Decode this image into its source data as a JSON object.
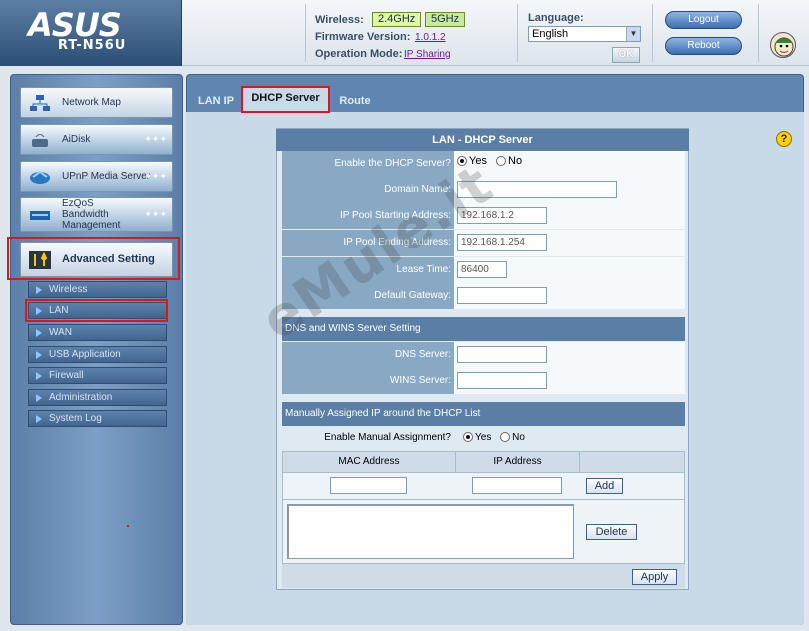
{
  "brand": {
    "logo": "ASUS",
    "model": "RT-N56U"
  },
  "header": {
    "wireless_label": "Wireless:",
    "band1": "2.4GHz",
    "band2": "5GHz",
    "firmware_label": "Firmware Version:",
    "firmware_value": "1.0.1.2",
    "mode_label": "Operation Mode:",
    "mode_value": "IP Sharing",
    "language_label": "Language:",
    "language_value": "English",
    "ok_label": "OK",
    "logout_label": "Logout",
    "reboot_label": "Reboot"
  },
  "sidebar": {
    "main": [
      {
        "label": "Network Map",
        "icon": "network-map-icon"
      },
      {
        "label": "AiDisk",
        "icon": "aidisk-icon"
      },
      {
        "label": "UPnP Media Server",
        "icon": "media-server-icon"
      },
      {
        "label": "EzQoS Bandwidth Management",
        "icon": "ezqos-icon"
      },
      {
        "label": "Advanced Setting",
        "icon": "advanced-setting-icon"
      }
    ],
    "sub": [
      "Wireless",
      "LAN",
      "WAN",
      "USB Application",
      "Firewall",
      "Administration",
      "System Log"
    ]
  },
  "tabs": [
    "LAN IP",
    "DHCP Server",
    "Route"
  ],
  "form": {
    "title": "LAN - DHCP Server",
    "enable_dhcp_label": "Enable the DHCP Server?",
    "yes": "Yes",
    "no": "No",
    "domain_name_label": "Domain Name:",
    "domain_name_value": "",
    "pool_start_label": "IP Pool Starting Address:",
    "pool_start_value": "192.168.1.2",
    "pool_end_label": "IP Pool Ending Address:",
    "pool_end_value": "192.168.1.254",
    "lease_label": "Lease Time:",
    "lease_value": "86400",
    "gateway_label": "Default Gateway:",
    "gateway_value": "",
    "dns_section": "DNS and WINS Server Setting",
    "dns_label": "DNS Server:",
    "dns_value": "",
    "wins_label": "WINS Server:",
    "wins_value": "",
    "manual_section": "Manually Assigned IP around the DHCP List",
    "enable_manual_label": "Enable Manual Assignment?",
    "mac_header": "MAC Address",
    "ip_header": "IP Address",
    "add_label": "Add",
    "delete_label": "Delete",
    "apply_label": "Apply"
  },
  "watermark": "eMule.it",
  "colors": {
    "highlight_red": "#e0141a",
    "panel_blue": "#5a7ea6"
  }
}
